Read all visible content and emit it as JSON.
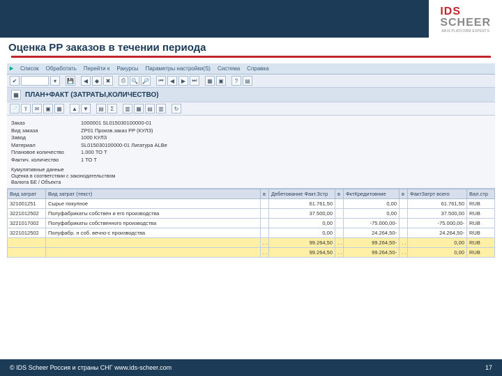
{
  "slide": {
    "title": "Оценка PP заказов в течении периода",
    "footer_left": "© IDS Scheer Россия и страны СНГ    www.ids-scheer.com",
    "page_num": "17",
    "logo": {
      "main1": "IDS",
      "main2": "SCHEER",
      "tag": "ARIS PLATFORM EXPERTS"
    }
  },
  "menu": {
    "items": [
      "Список",
      "Обработать",
      "Перейти к",
      "Ракурсы",
      "Параметры настройки(S)",
      "Система",
      "Справка"
    ]
  },
  "section_title": "ПЛАН+ФАКТ (ЗАТРАТЫ,КОЛИЧЕСТВО)",
  "details": {
    "rows": [
      {
        "label": "Заказ",
        "value": "1000001 SL015030100000-01"
      },
      {
        "label": "Вид заказа",
        "value": "ZP01 Произв.заказ PP (КУЛЗ)"
      },
      {
        "label": "Завод",
        "value": "1000 КУЛЗ"
      },
      {
        "label": "Материал",
        "value": "SL015030100000-01 Лигатура ALBe"
      },
      {
        "label": "Плановое количество",
        "value": "1.000 ТО Т"
      },
      {
        "label": "Фактич. количество",
        "value": "1 ТО Т"
      }
    ],
    "cum": {
      "l1": "Кумулятивные данные",
      "l2": "Оценка в соответствии с законодательством",
      "l3": "Валюта БЕ / Объекта"
    }
  },
  "table": {
    "cols": [
      "Вид затрат",
      "Вид затрат (текст)",
      "в",
      "Дебетование Факт.Зстр",
      "в",
      "ФктКредитовние",
      "в",
      "ФактЗатрт всего",
      "Вал.стр"
    ],
    "rows": [
      {
        "y": false,
        "c": [
          "321001251",
          "Сырье покупное",
          "",
          "61.761,50",
          "",
          "0,00",
          "",
          "61.761,50",
          "RUB"
        ]
      },
      {
        "y": false,
        "c": [
          "3221012502",
          "Полуфабрикаты собствен и его производства",
          "",
          "37.500,00",
          "",
          "0,00",
          "",
          "37.500,00",
          "RUB"
        ]
      },
      {
        "y": false,
        "c": [
          "3221017002",
          "Полуфабрикаты собственного производства",
          "",
          "0,00",
          "",
          "-75.000,00-",
          "",
          "-75.000,00-",
          "RUB"
        ]
      },
      {
        "y": false,
        "c": [
          "3221012502",
          "Полуфабр. н соб. вечно-c производства",
          "",
          "0,00",
          "",
          "24.264,50-",
          "",
          "24.264,50-",
          "RUB"
        ]
      },
      {
        "y": true,
        "c": [
          "",
          "",
          ". .",
          "99.264,50",
          ". .",
          "99.264,50-",
          ". .",
          "0,00",
          "RUB"
        ]
      },
      {
        "y": true,
        "c": [
          "",
          "",
          ". .",
          "99.264,50",
          ". .",
          "99.264,50-",
          ". .",
          "0,00",
          "RUB"
        ]
      }
    ]
  }
}
